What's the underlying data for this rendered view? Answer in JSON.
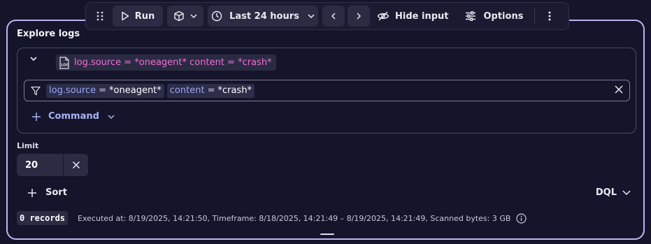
{
  "toolbar": {
    "run_label": "Run",
    "timeframe_label": "Last 24 hours",
    "hide_input_label": "Hide input",
    "options_label": "Options"
  },
  "panel": {
    "title": "Explore logs"
  },
  "query": {
    "summary": "log.source = *oneagent* content = *crash*",
    "filters": [
      {
        "key": "log.source",
        "op": "=",
        "value": "*oneagent*"
      },
      {
        "key": "content",
        "op": "=",
        "value": "*crash*"
      }
    ],
    "command_label": "Command"
  },
  "limit": {
    "label": "Limit",
    "value": "20"
  },
  "sort_label": "Sort",
  "mode_label": "DQL",
  "status": {
    "records": "0 records",
    "executed": "Executed at: 8/19/2025, 14:21:50, Timeframe: 8/18/2025, 14:21:49 – 8/19/2025, 14:21:49, Scanned bytes: 3 GB"
  },
  "colors": {
    "accent_border": "#bdb4f0",
    "query_pink": "#f06ed4",
    "filter_key": "#9aa6f5",
    "background": "#14152a"
  }
}
